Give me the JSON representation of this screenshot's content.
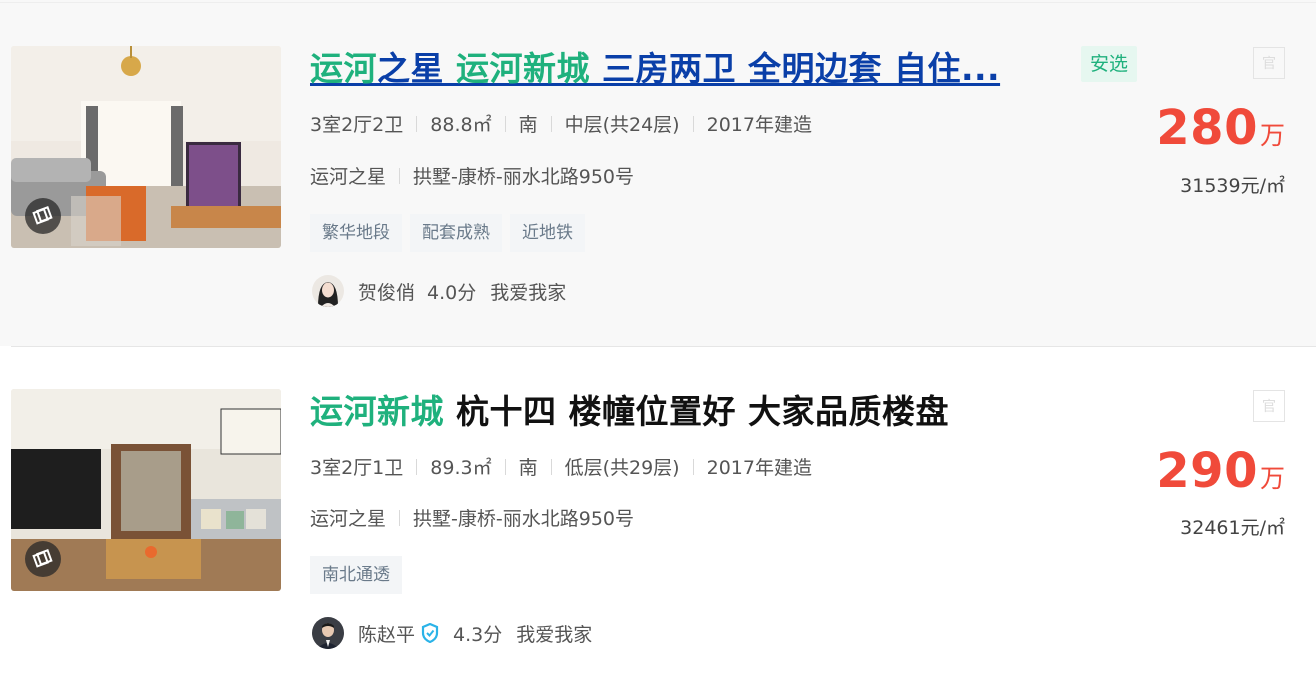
{
  "listings": [
    {
      "title_keywords": [
        "运河",
        "运河新城"
      ],
      "title_parts": [
        "运河",
        "之星 ",
        "运河新城",
        " 三房两卫 全明边套 自住..."
      ],
      "badge": "安选",
      "official_icon": "官",
      "layout": "3室2厅2卫",
      "area": "88.8㎡",
      "orientation": "南",
      "floor": "中层(共24层)",
      "built": "2017年建造",
      "community": "运河之星",
      "address": "拱墅-康桥-丽水北路950号",
      "tags": [
        "繁华地段",
        "配套成熟",
        "近地铁"
      ],
      "agent_name": "贺俊俏",
      "agent_score": "4.0分",
      "agent_company": "我爱我家",
      "price": "280",
      "price_unit": "万",
      "unit_price": "31539元/㎡"
    },
    {
      "title_keywords": [
        "运河新城"
      ],
      "title_parts": [
        "运河新城",
        " 杭十四 楼幢位置好 大家品质楼盘"
      ],
      "official_icon": "官",
      "layout": "3室2厅1卫",
      "area": "89.3㎡",
      "orientation": "南",
      "floor": "低层(共29层)",
      "built": "2017年建造",
      "community": "运河之星",
      "address": "拱墅-康桥-丽水北路950号",
      "tags": [
        "南北通透"
      ],
      "agent_name": "陈赵平",
      "agent_verified_icon": "shield-check-icon",
      "agent_score": "4.3分",
      "agent_company": "我爱我家",
      "price": "290",
      "price_unit": "万",
      "unit_price": "32461元/㎡"
    }
  ],
  "colors": {
    "keyword_green": "#1fb17d",
    "link_blue": "#0a3fa8",
    "price_red": "#f04a3a",
    "hover_bg": "#f8f8f8"
  }
}
